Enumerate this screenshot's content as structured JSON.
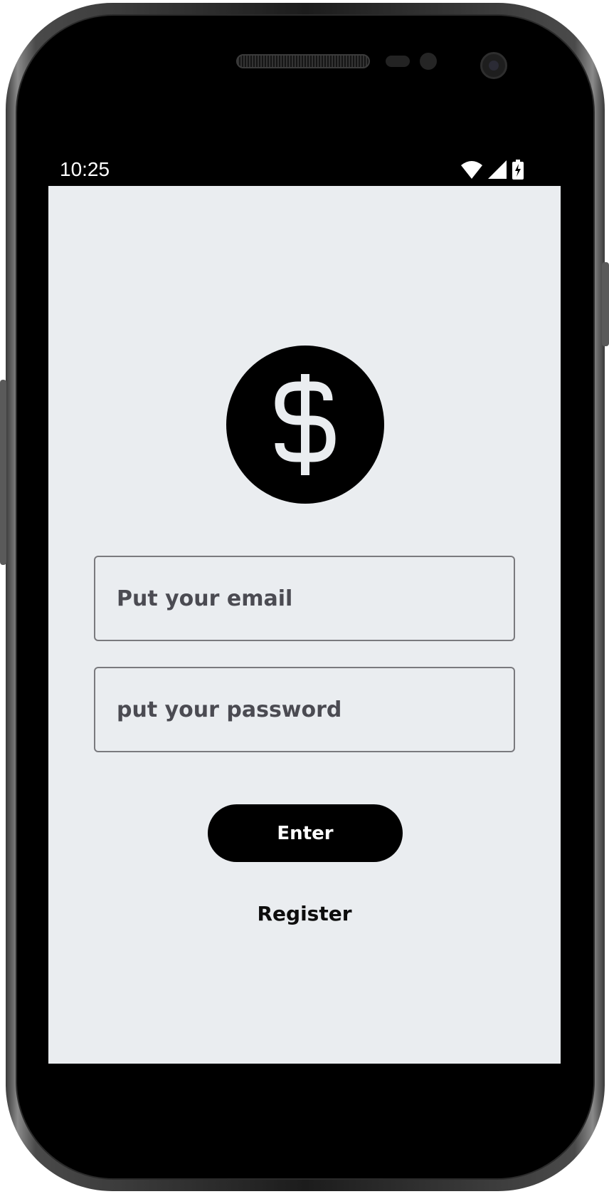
{
  "status_bar": {
    "time": "10:25",
    "icons": [
      "wifi-icon",
      "signal-icon",
      "battery-charging-icon"
    ]
  },
  "logo": {
    "icon": "dollar-icon"
  },
  "form": {
    "email_placeholder": "Put your email",
    "password_placeholder": "put your password",
    "enter_label": "Enter",
    "register_label": "Register"
  },
  "colors": {
    "screen_background": "#eaedf0",
    "primary": "#000000",
    "placeholder_text": "#4b4b52",
    "field_border": "#7a7a7e"
  }
}
